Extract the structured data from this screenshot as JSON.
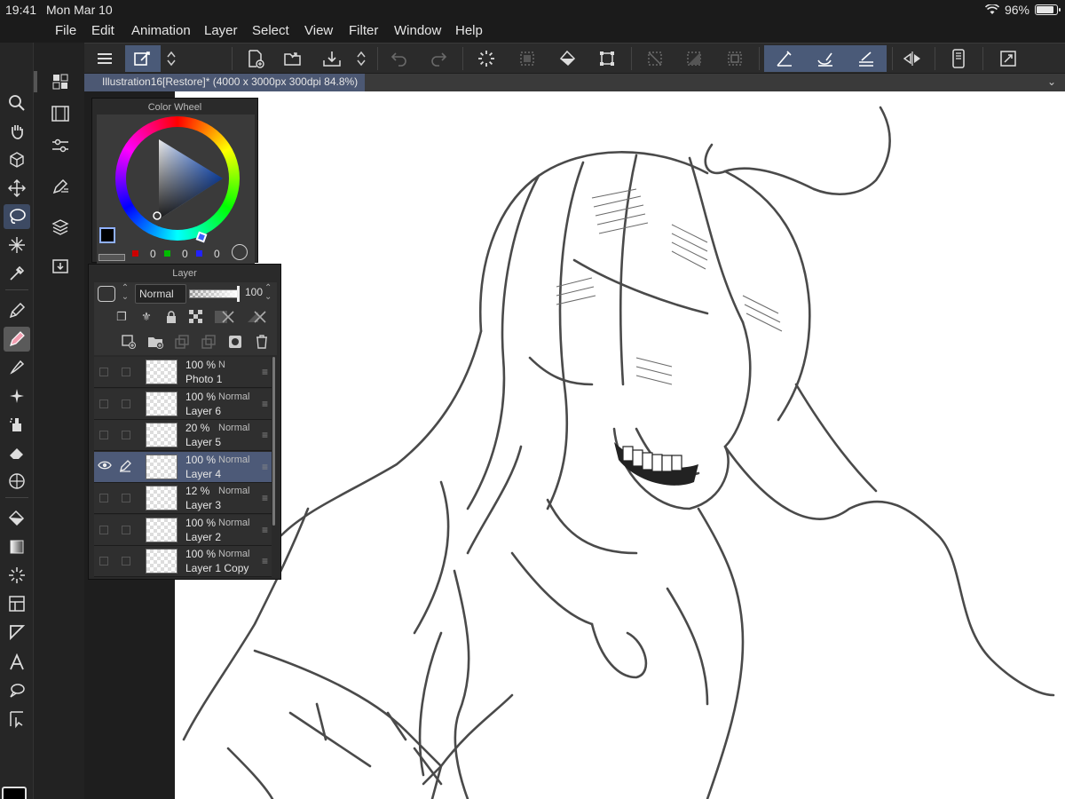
{
  "status_bar": {
    "time": "19:41",
    "date": "Mon Mar 10",
    "battery": "96%",
    "battery_level": 0.96
  },
  "menu": {
    "items": [
      "File",
      "Edit",
      "Animation",
      "Layer",
      "Select",
      "View",
      "Filter",
      "Window",
      "Help"
    ]
  },
  "command_bar": {
    "buttons": [
      {
        "icon": "menu-icon"
      },
      {
        "icon": "quick-access-icon",
        "active": true
      },
      {
        "icon": "up-down-arrows-icon"
      },
      {
        "icon": "new-canvas-icon"
      },
      {
        "icon": "open-folder-icon"
      },
      {
        "icon": "save-icon"
      },
      {
        "icon": "up-down-arrows-icon"
      },
      {
        "icon": "undo-icon",
        "dim": true
      },
      {
        "icon": "redo-icon",
        "dim": true
      },
      {
        "icon": "loading-icon"
      },
      {
        "icon": "clear-icon",
        "dim": true
      },
      {
        "icon": "fill-icon"
      },
      {
        "icon": "transform-icon"
      },
      {
        "icon": "deselect-icon",
        "dim": true
      },
      {
        "icon": "invert-selection-icon",
        "dim": true
      },
      {
        "icon": "selection-border-icon",
        "dim": true
      },
      {
        "icon": "ruler-snap-icon",
        "active": true
      },
      {
        "icon": "special-ruler-snap-icon",
        "active": true
      },
      {
        "icon": "grid-snap-icon",
        "active": true
      },
      {
        "icon": "flip-horizontal-icon"
      },
      {
        "icon": "smartphone-icon"
      },
      {
        "icon": "fit-screen-icon"
      }
    ]
  },
  "document_tab": {
    "label": "Illustration16[Restore]* (4000 x 3000px 300dpi 84.8%)"
  },
  "tools": [
    "zoom-icon",
    "hand-icon",
    "rotate-3d-icon",
    "move-icon",
    "lasso-select-icon",
    "magic-wand-icon",
    "eyedropper-icon",
    "pen-icon",
    "pencil-icon",
    "brush-icon",
    "airbrush-icon",
    "decoration-icon",
    "eraser-icon",
    "blend-icon",
    "fill-bucket-icon",
    "gradient-icon",
    "figure-icon",
    "frame-icon",
    "ruler-icon",
    "text-icon",
    "balloon-icon",
    "operation-icon"
  ],
  "palette_dock": [
    "color-set-icon",
    "animation-timeline-icon",
    "tool-property-icon",
    "sub-tool-icon",
    "layer-property-icon",
    "material-icon"
  ],
  "colors": {
    "main": "#000000",
    "sub": "#3a2654",
    "accent": "#4c5873",
    "selected_row": "#4d5a78"
  },
  "color_wheel": {
    "title": "Color Wheel",
    "r": "0",
    "g": "0",
    "b": "0"
  },
  "layer_panel": {
    "title": "Layer",
    "blend_mode": "Normal",
    "opacity": "100",
    "layers": [
      {
        "opacity": "100 %",
        "mode": "N",
        "name": "Photo 1",
        "selected": false,
        "visible": false
      },
      {
        "opacity": "100 %",
        "mode": "Normal",
        "name": "Layer 6",
        "selected": false,
        "visible": false
      },
      {
        "opacity": "20 %",
        "mode": "Normal",
        "name": "Layer 5",
        "selected": false,
        "visible": false
      },
      {
        "opacity": "100 %",
        "mode": "Normal",
        "name": "Layer 4",
        "selected": true,
        "visible": true
      },
      {
        "opacity": "12 %",
        "mode": "Normal",
        "name": "Layer 3",
        "selected": false,
        "visible": false
      },
      {
        "opacity": "100 %",
        "mode": "Normal",
        "name": "Layer 2",
        "selected": false,
        "visible": false
      },
      {
        "opacity": "100 %",
        "mode": "Normal",
        "name": "Layer 1 Copy",
        "selected": false,
        "visible": false
      }
    ]
  }
}
